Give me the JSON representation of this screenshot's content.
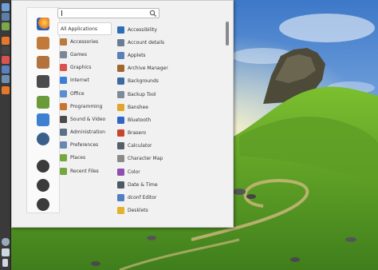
{
  "search": {
    "placeholder": "",
    "value": ""
  },
  "categories": [
    {
      "label": "All Applications",
      "icon": "all-applications-icon",
      "color": "#ffffff",
      "selected": true
    },
    {
      "label": "Accessories",
      "icon": "accessories-icon",
      "color": "#b87a3e"
    },
    {
      "label": "Games",
      "icon": "games-icon",
      "color": "#7b8794"
    },
    {
      "label": "Graphics",
      "icon": "graphics-icon",
      "color": "#d9534f"
    },
    {
      "label": "Internet",
      "icon": "internet-icon",
      "color": "#3b7dd8"
    },
    {
      "label": "Office",
      "icon": "office-icon",
      "color": "#5a8fcf"
    },
    {
      "label": "Programming",
      "icon": "programming-icon",
      "color": "#c8742f"
    },
    {
      "label": "Sound & Video",
      "icon": "sound-video-icon",
      "color": "#4a4a4a"
    },
    {
      "label": "Administration",
      "icon": "administration-icon",
      "color": "#5c6f86"
    },
    {
      "label": "Preferences",
      "icon": "preferences-icon",
      "color": "#6a87b0"
    },
    {
      "label": "Places",
      "icon": "places-folder-icon",
      "color": "#74a83f"
    },
    {
      "label": "Recent Files",
      "icon": "recent-files-folder-icon",
      "color": "#74a83f"
    }
  ],
  "apps": [
    {
      "label": "Accessibility",
      "icon": "accessibility-icon",
      "color": "#2f6db7"
    },
    {
      "label": "Account details",
      "icon": "account-details-icon",
      "color": "#6b7c93"
    },
    {
      "label": "Applets",
      "icon": "applets-icon",
      "color": "#5a80b8"
    },
    {
      "label": "Archive Manager",
      "icon": "archive-manager-icon",
      "color": "#a0662c"
    },
    {
      "label": "Backgrounds",
      "icon": "backgrounds-icon",
      "color": "#3c6aa0"
    },
    {
      "label": "Backup Tool",
      "icon": "backup-tool-icon",
      "color": "#7d8a97"
    },
    {
      "label": "Banshee",
      "icon": "banshee-icon",
      "color": "#e0a52a"
    },
    {
      "label": "Bluetooth",
      "icon": "bluetooth-icon",
      "color": "#2f66c4"
    },
    {
      "label": "Brasero",
      "icon": "brasero-icon",
      "color": "#c9452f"
    },
    {
      "label": "Calculator",
      "icon": "calculator-icon",
      "color": "#555f69"
    },
    {
      "label": "Character Map",
      "icon": "character-map-icon",
      "color": "#8a8a8a"
    },
    {
      "label": "Color",
      "icon": "color-icon",
      "color": "#8e4fb0"
    },
    {
      "label": "Date & Time",
      "icon": "date-time-icon",
      "color": "#4b5866"
    },
    {
      "label": "dconf Editor",
      "icon": "dconf-editor-icon",
      "color": "#4f7fc0"
    },
    {
      "label": "Desklets",
      "icon": "desklets-icon",
      "color": "#e3b12c"
    }
  ],
  "favorites": [
    {
      "icon": "firefox-icon",
      "color": "#e6782b"
    },
    {
      "icon": "software-manager-icon",
      "color": "#c27a3a"
    },
    {
      "icon": "package-manager-icon",
      "color": "#b2733c"
    },
    {
      "icon": "system-settings-icon",
      "color": "#4b4b4b"
    },
    {
      "icon": "terminal-icon",
      "color": "#6a9a3a"
    },
    {
      "icon": "software-center-icon",
      "color": "#3f7fd0"
    },
    {
      "icon": "nemo-files-icon",
      "color": "#3a5f8a"
    },
    {
      "icon": "lock-screen-icon",
      "color": "#3b3b3b"
    },
    {
      "icon": "logout-icon",
      "color": "#3b3b3b"
    },
    {
      "icon": "shutdown-icon",
      "color": "#3b3b3b"
    }
  ],
  "panel_icons": [
    {
      "icon": "menu-icon",
      "color": "#6f9fd8"
    },
    {
      "icon": "show-desktop-icon",
      "color": "#5b7fa8"
    },
    {
      "icon": "files-icon",
      "color": "#7aa84a"
    },
    {
      "icon": "firefox-icon",
      "color": "#e6782b"
    },
    {
      "icon": "terminal-icon",
      "color": "#444444"
    },
    {
      "icon": "software-manager-icon",
      "color": "#d9534f"
    },
    {
      "icon": "settings-icon",
      "color": "#5a80c0"
    },
    {
      "icon": "network-icon",
      "color": "#6f8fb0"
    },
    {
      "icon": "firefox-window-icon",
      "color": "#e6782b"
    },
    {
      "icon": "shield-icon",
      "color": "#9aa9b8"
    },
    {
      "icon": "network-tray-icon",
      "color": "#cfd7df"
    },
    {
      "icon": "battery-icon",
      "color": "#cfd7df"
    }
  ]
}
